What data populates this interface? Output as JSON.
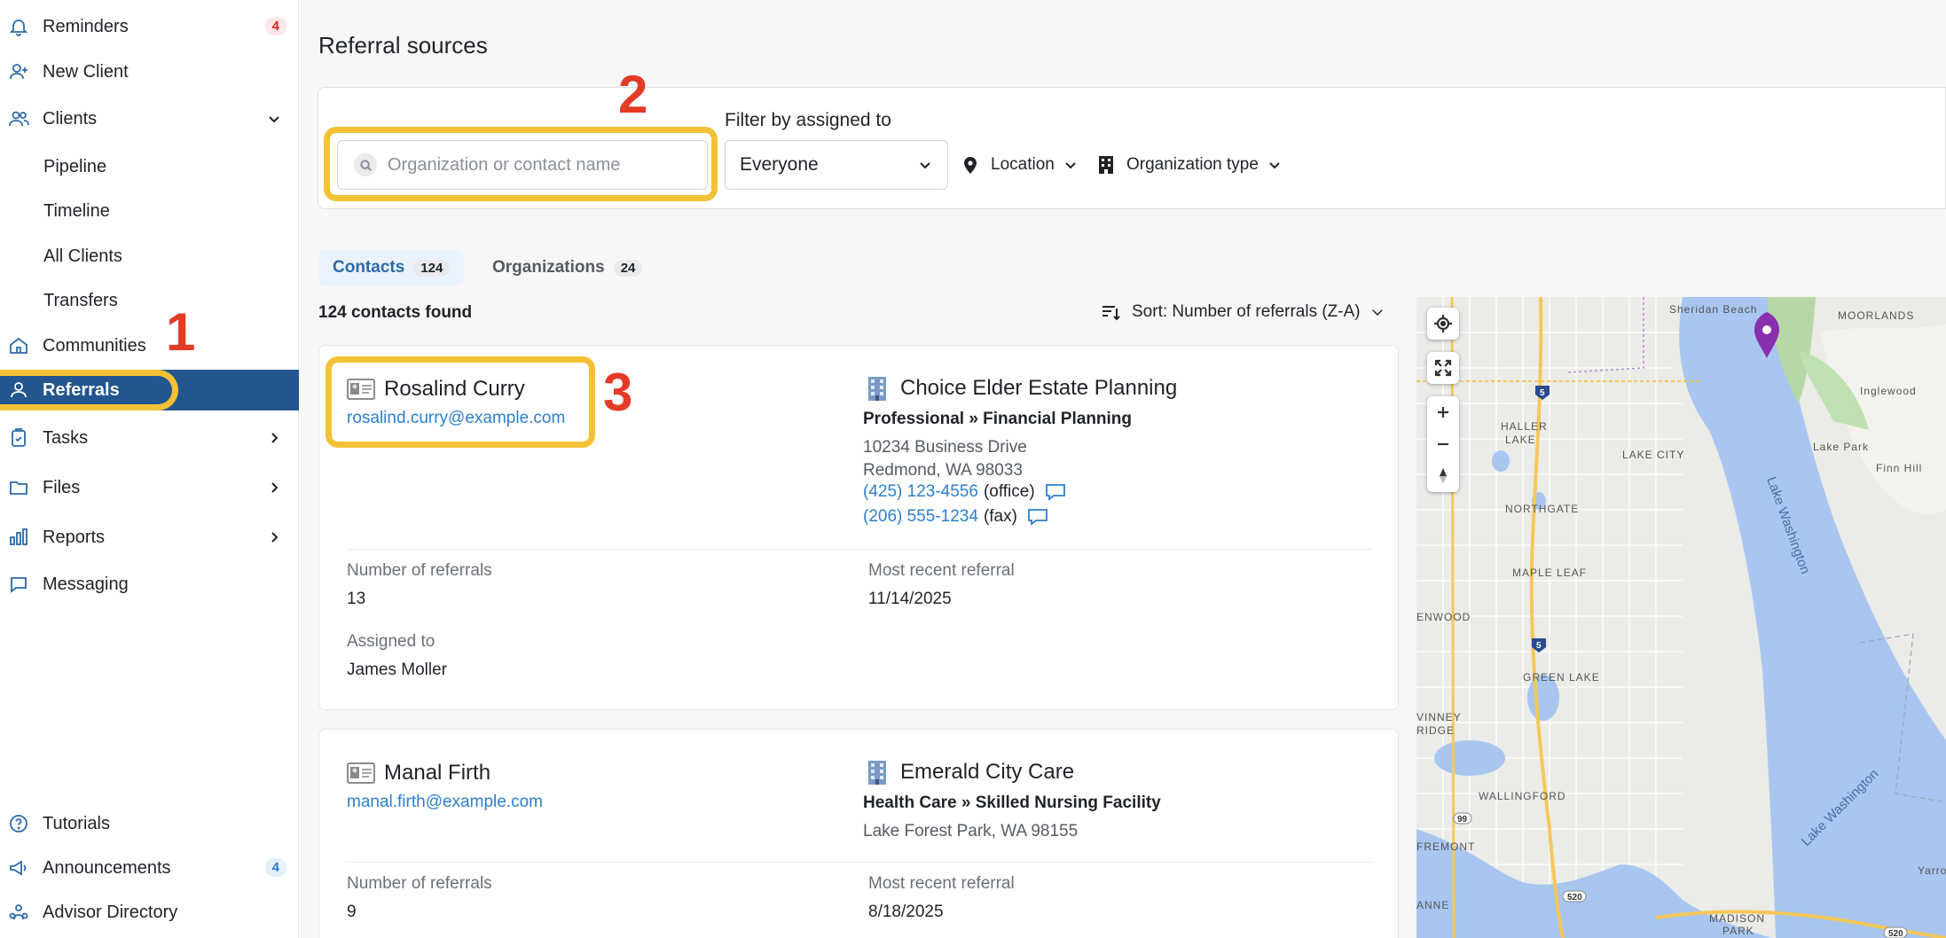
{
  "sidebar": {
    "items": [
      {
        "label": "Reminders",
        "badge": "4"
      },
      {
        "label": "New Client"
      },
      {
        "label": "Clients"
      },
      {
        "label": "Communities"
      },
      {
        "label": "Referrals"
      },
      {
        "label": "Tasks"
      },
      {
        "label": "Files"
      },
      {
        "label": "Reports"
      },
      {
        "label": "Messaging"
      },
      {
        "label": "Tutorials"
      },
      {
        "label": "Announcements",
        "badge": "4"
      },
      {
        "label": "Advisor Directory"
      }
    ],
    "client_subitems": [
      "Pipeline",
      "Timeline",
      "All Clients",
      "Transfers"
    ]
  },
  "annotations": {
    "one": "1",
    "two": "2",
    "three": "3"
  },
  "page": {
    "title": "Referral sources"
  },
  "filters": {
    "search_placeholder": "Organization or contact name",
    "assigned_label": "Filter by assigned to",
    "assigned_value": "Everyone",
    "location_label": "Location",
    "org_type_label": "Organization type"
  },
  "tabs": [
    {
      "label": "Contacts",
      "count": "124",
      "active": true
    },
    {
      "label": "Organizations",
      "count": "24",
      "active": false
    }
  ],
  "results": {
    "found_text": "124 contacts found",
    "sort_label": "Sort: Number of referrals (Z-A)"
  },
  "contacts": [
    {
      "name": "Rosalind Curry",
      "email": "rosalind.curry@example.com",
      "org_name": "Choice Elder Estate Planning",
      "org_type": "Professional » Financial Planning",
      "address_line1": "10234 Business Drive",
      "address_line2": "Redmond, WA 98033",
      "phones": [
        {
          "number": "(425) 123-4556",
          "kind": "(office)"
        },
        {
          "number": "(206) 555-1234",
          "kind": "(fax)"
        }
      ],
      "referrals_label": "Number of referrals",
      "referrals": "13",
      "recent_label": "Most recent referral",
      "recent": "11/14/2025",
      "assigned_label": "Assigned to",
      "assigned": "James Moller"
    },
    {
      "name": "Manal Firth",
      "email": "manal.firth@example.com",
      "org_name": "Emerald City Care",
      "org_type": "Health Care » Skilled Nursing Facility",
      "address_line1": "Lake Forest Park, WA 98155",
      "referrals_label": "Number of referrals",
      "referrals": "9",
      "recent_label": "Most recent referral",
      "recent": "8/18/2025"
    }
  ],
  "map": {
    "labels": [
      "Sheridan Beach",
      "MOORLANDS",
      "Inglewood",
      "HALLER",
      "LAKE",
      "LAKE CITY",
      "Lake Park",
      "Finn Hill",
      "NORTHGATE",
      "Lake Washington",
      "MAPLE LEAF",
      "ENWOOD",
      "GREEN LAKE",
      "VINNEY",
      "RIDGE",
      "WALLINGFORD",
      "FREMONT",
      "ANNE",
      "MADISON",
      "PARK",
      "Yarro"
    ],
    "highway_labels": [
      "5",
      "5",
      "99",
      "520",
      "520"
    ]
  }
}
